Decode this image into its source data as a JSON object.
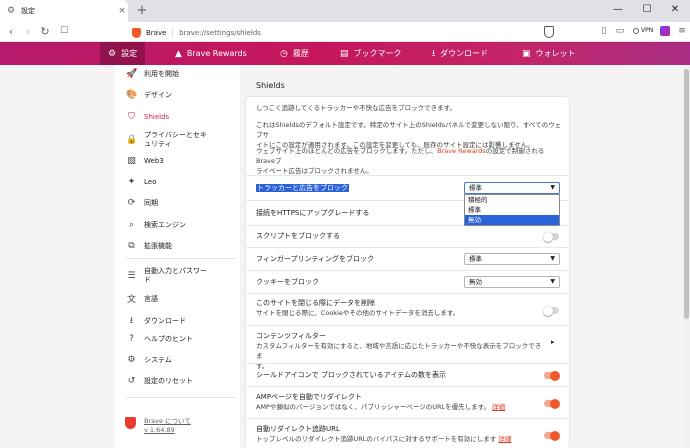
{
  "tab": {
    "title": "設定",
    "close": "×",
    "new_tab": "+"
  },
  "window": {
    "minimize": "—",
    "maximize": "☐",
    "close": "✕"
  },
  "toolbar": {
    "back": "‹",
    "forward": "›",
    "reload": "↻",
    "brand": "Brave",
    "separator": "|",
    "url": "brave://settings/shields",
    "vpn": "VPN"
  },
  "topnav": [
    {
      "label": "設定",
      "icon": "⚙"
    },
    {
      "label": "Brave Rewards",
      "icon": "▲"
    },
    {
      "label": "履歴",
      "icon": "◷"
    },
    {
      "label": "ブックマーク",
      "icon": "▤"
    },
    {
      "label": "ダウンロード",
      "icon": "⭳"
    },
    {
      "label": "ウォレット",
      "icon": "▣"
    }
  ],
  "sidebar": {
    "items": [
      {
        "label": "利用を開始",
        "icon": "🚀"
      },
      {
        "label": "デザイン",
        "icon": "🎨"
      },
      {
        "label": "Shields",
        "icon": "⛉"
      },
      {
        "label_1": "プライバシーとセキ",
        "label_2": "ュリティ",
        "icon": "🔒"
      },
      {
        "label": "Web3",
        "icon": "▧"
      },
      {
        "label": "Leo",
        "icon": "✦"
      },
      {
        "label": "同期",
        "icon": "⟳"
      },
      {
        "label": "検索エンジン",
        "icon": "⌕"
      },
      {
        "label": "拡張機能",
        "icon": "⧉"
      },
      {
        "label_1": "自動入力とパスワー",
        "label_2": "ド",
        "icon": "☰"
      },
      {
        "label": "言語",
        "icon": "文"
      },
      {
        "label": "ダウンロード",
        "icon": "⭳"
      },
      {
        "label": "ヘルプのヒント",
        "icon": "?"
      },
      {
        "label": "システム",
        "icon": "⚙"
      },
      {
        "label": "設定のリセット",
        "icon": "↺"
      }
    ],
    "footer": {
      "line1": "Brave について",
      "line2": "v 1.64.89"
    }
  },
  "shields": {
    "section_title": "Shields",
    "intro1": "しつこく追跡してくるトラッカーや不快な広告をブロックできます。",
    "intro2_line1": "これはShieldsのデフォルト設定です。特定のサイト上のShieldsパネルで変更しない限り、すべてのウェブサ",
    "intro2_line2": "イトにこの設定が適用されます。この設定を変更しても、既存のサイト設定には影響しません。",
    "intro3_line1a": "ウェブサイト上のほとんどの広告をブロックします。ただし、",
    "intro3_link": "Brave Rewards",
    "intro3_line1b": "の設定で制御されるBraveプ",
    "intro3_line2": "ライベート広告はブロックされません。",
    "tracker_label": "トラッカーと広告をブロック",
    "tracker_value": "標準",
    "tracker_options": [
      "積極的",
      "標準",
      "無効"
    ],
    "tracker_highlighted": "無効",
    "https_label": "接続をHTTPSにアップグレードする",
    "scripts_label": "スクリプトをブロックする",
    "fingerprint_label": "フィンガープリンティングをブロック",
    "fingerprint_value": "標準",
    "cookie_label": "クッキーをブロック",
    "cookie_value": "無効",
    "clear_label": "このサイトを閉じる際にデータを削除",
    "clear_sub": "サイトを閉じる際に、Cookieやその他のサイトデータを消去します。",
    "filters_label": "コンテンツフィルター",
    "filters_sub": "カスタムフィルターを有効にすると、地域や言語に応じたトラッカーや不快な表示をブロックできま",
    "filters_sub2": "す。",
    "count_label": "シールドアイコンで ブロックされているアイテムの数を表示",
    "amp_label": "AMPページを自動でリダイレクト",
    "amp_sub": "AMPや類似のバージョンではなく、パブリッシャーページのURLを優先します。",
    "amp_link": "詳細",
    "debounce_label": "自動リダイレクト追跡URL",
    "debounce_sub": "トップレベルのリダイレクト追跡URLのバイパスに対するサポートを有効にします",
    "debounce_link": "詳細",
    "toggles": {
      "scripts": false,
      "clear": false,
      "count": true,
      "amp": true,
      "debounce": true
    }
  },
  "colors": {
    "accent": "#c91e5a",
    "nav_start": "#b61a6c",
    "nav_end": "#a92d84",
    "toggle_on": "#ec5a2e",
    "selection": "#2962d9"
  }
}
